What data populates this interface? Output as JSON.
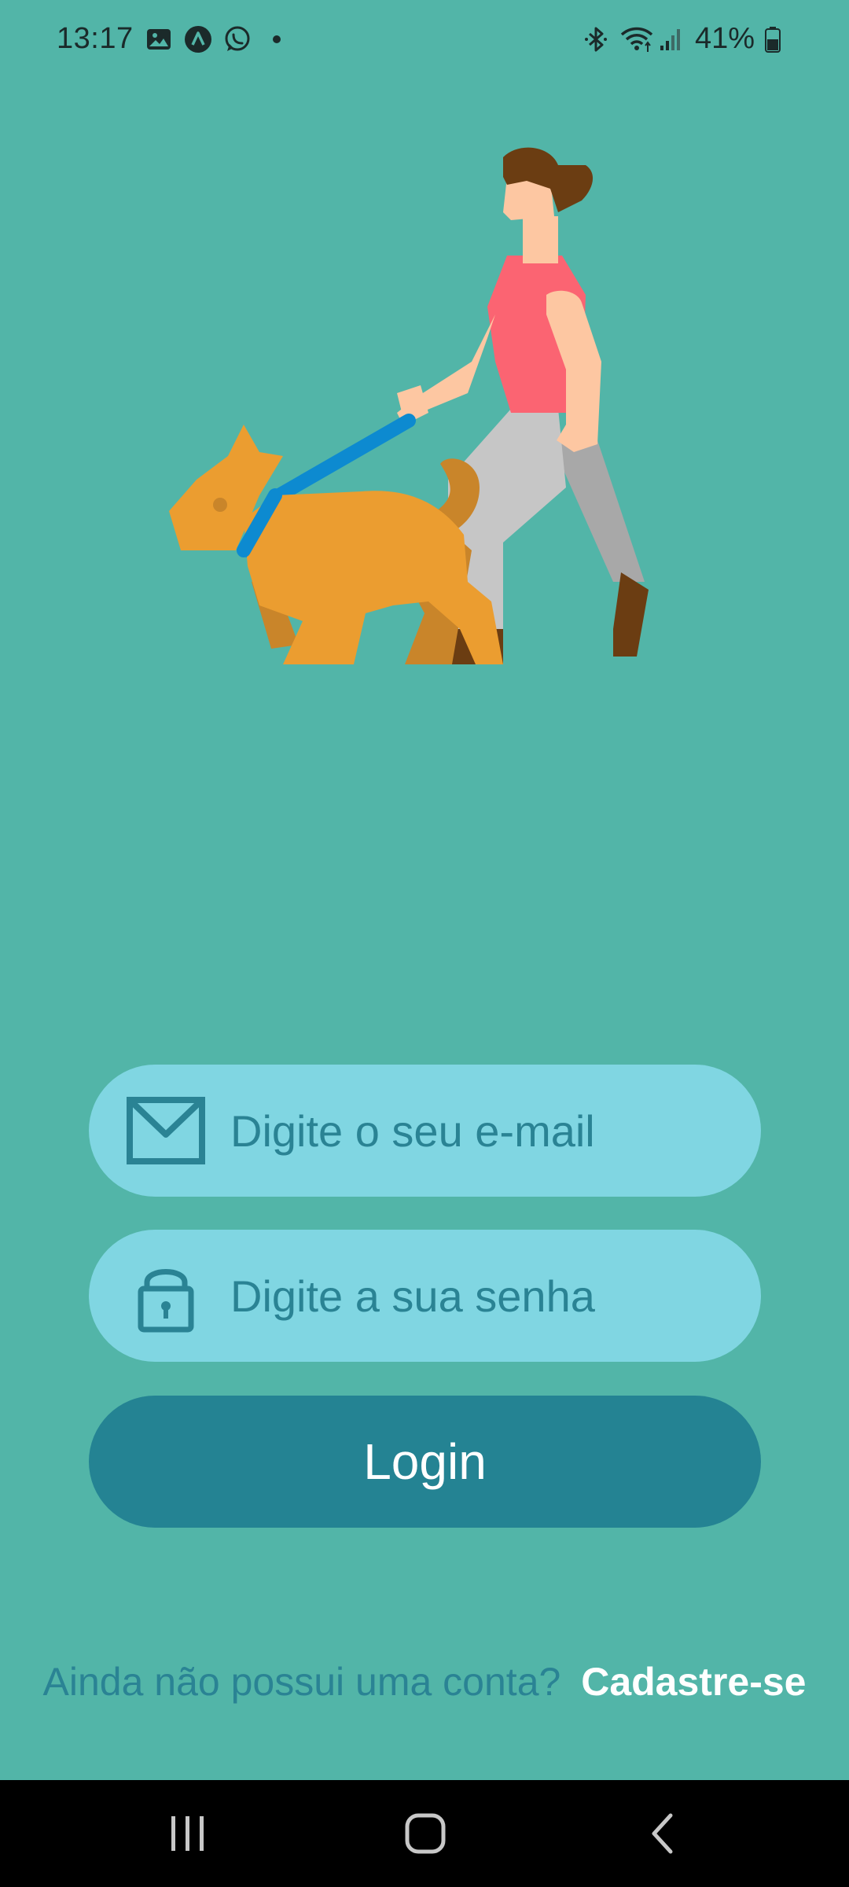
{
  "status_bar": {
    "time": "13:17",
    "battery_percent": "41%",
    "icons": [
      "gallery-icon",
      "app-a-icon",
      "whatsapp-icon",
      "notification-dot-icon",
      "bluetooth-icon",
      "wifi-icon",
      "signal-icon",
      "battery-icon"
    ]
  },
  "illustration": {
    "subject": "woman-walking-dog"
  },
  "login_form": {
    "email_placeholder": "Digite o seu e-mail",
    "password_placeholder": "Digite a sua senha",
    "email_icon": "mail-icon",
    "password_icon": "lock-icon",
    "login_label": "Login"
  },
  "signup": {
    "question": "Ainda não possui uma conta?",
    "link": "Cadastre-se"
  },
  "nav_bar": {
    "buttons": [
      "recents",
      "home",
      "back"
    ]
  },
  "colors": {
    "background": "#52b5a8",
    "field": "#80d6e2",
    "field_text": "#2a8394",
    "button": "#248393",
    "button_text": "#ffffff"
  }
}
